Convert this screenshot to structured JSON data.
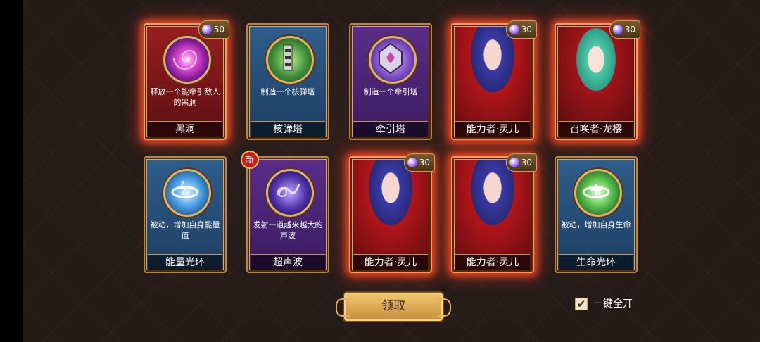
{
  "cards": [
    {
      "id": "black-hole",
      "name": "黑洞",
      "desc": "释放一个能牵引敌人的黑洞",
      "cost": "50",
      "style": "red",
      "icon": "black-hole-icon"
    },
    {
      "id": "nuke-tower",
      "name": "核弹塔",
      "desc": "制造一个核弹塔",
      "style": "blue",
      "icon": "nuke-tower-icon"
    },
    {
      "id": "traction-tower",
      "name": "牵引塔",
      "desc": "制造一个牵引塔",
      "style": "purple",
      "icon": "traction-tower-icon"
    },
    {
      "id": "ability-linger-1",
      "name": "能力者·灵儿",
      "cost": "30",
      "style": "red",
      "icon": "character-portrait"
    },
    {
      "id": "summoner-longying",
      "name": "召唤者·龙樱",
      "cost": "30",
      "style": "red",
      "icon": "character-portrait"
    },
    {
      "id": "energy-aura",
      "name": "能量光环",
      "desc": "被动，增加自身能量值",
      "style": "blue",
      "icon": "energy-aura-icon"
    },
    {
      "id": "ultrasonic",
      "name": "超声波",
      "desc": "发射一道越来越大的声波",
      "style": "purple",
      "badge": "新",
      "icon": "sound-wave-icon"
    },
    {
      "id": "ability-linger-2",
      "name": "能力者·灵儿",
      "cost": "30",
      "style": "red",
      "icon": "character-portrait"
    },
    {
      "id": "ability-linger-3",
      "name": "能力者·灵儿",
      "cost": "30",
      "style": "red",
      "icon": "character-portrait"
    },
    {
      "id": "life-aura",
      "name": "生命光环",
      "desc": "被动，增加自身生命",
      "style": "blue",
      "icon": "life-aura-icon"
    }
  ],
  "claim_button": "领取",
  "auto_open": {
    "label": "一键全开",
    "checked": true,
    "mark": "✔"
  }
}
